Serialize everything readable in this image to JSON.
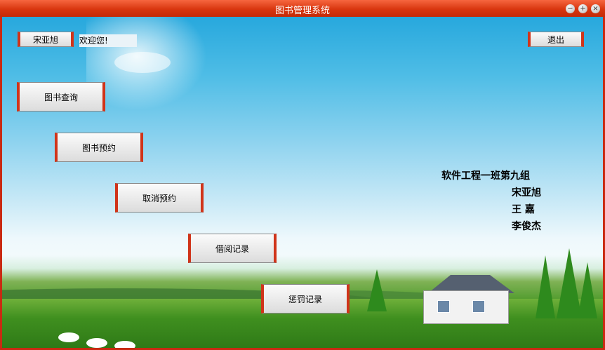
{
  "window": {
    "title": "图书管理系统",
    "controls": [
      "minimize-icon",
      "maximize-icon",
      "close-icon"
    ]
  },
  "header": {
    "user_button": "宋亚旭",
    "welcome_text": "欢迎您!",
    "logout_button": "退出"
  },
  "menu": {
    "items": [
      {
        "label": "图书查询"
      },
      {
        "label": "图书预约"
      },
      {
        "label": "取消预约"
      },
      {
        "label": "借阅记录"
      },
      {
        "label": "惩罚记录"
      }
    ]
  },
  "team": {
    "group": "软件工程一班第九组",
    "members": [
      "宋亚旭",
      "王 嘉",
      "李俊杰"
    ]
  }
}
